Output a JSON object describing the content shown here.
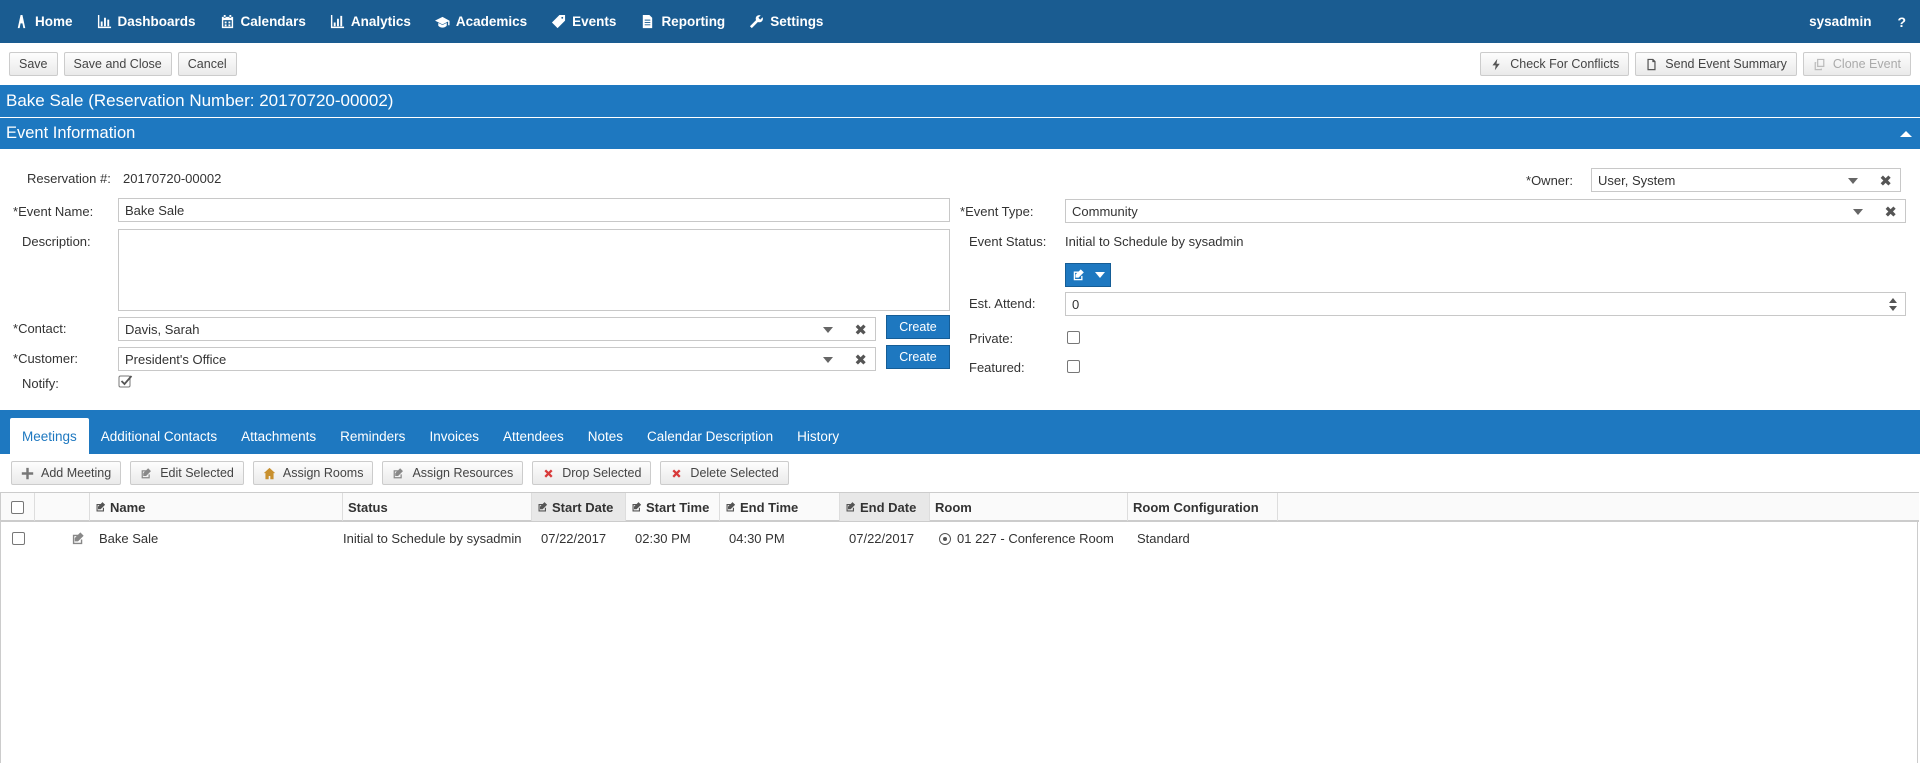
{
  "nav": {
    "items": [
      {
        "label": "Home",
        "icon": "tower-icon"
      },
      {
        "label": "Dashboards",
        "icon": "bar-chart-icon"
      },
      {
        "label": "Calendars",
        "icon": "calendar-icon"
      },
      {
        "label": "Analytics",
        "icon": "analytics-icon"
      },
      {
        "label": "Academics",
        "icon": "graduation-cap-icon"
      },
      {
        "label": "Events",
        "icon": "tag-icon"
      },
      {
        "label": "Reporting",
        "icon": "document-icon"
      },
      {
        "label": "Settings",
        "icon": "wrench-icon"
      }
    ],
    "user": "sysadmin",
    "help": "?"
  },
  "toolbar": {
    "save": "Save",
    "save_close": "Save and Close",
    "cancel": "Cancel",
    "check_conflicts": "Check For Conflicts",
    "send_summary": "Send Event Summary",
    "clone_event": "Clone Event"
  },
  "title": "Bake Sale (Reservation Number: 20170720-00002)",
  "section": "Event Information",
  "form": {
    "reservation_label": "Reservation #:",
    "reservation_value": "20170720-00002",
    "event_name_label": "Event Name:",
    "event_name_value": "Bake Sale",
    "description_label": "Description:",
    "contact_label": "Contact:",
    "contact_value": "Davis, Sarah",
    "customer_label": "Customer:",
    "customer_value": "President's Office",
    "notify_label": "Notify:",
    "create_label": "Create",
    "required_mark": "*",
    "owner_label": "Owner:",
    "owner_value": "User, System",
    "event_type_label": "Event Type:",
    "event_type_value": "Community",
    "event_status_label": "Event Status:",
    "event_status_value": "Initial to Schedule by sysadmin",
    "est_attend_label": "Est. Attend:",
    "est_attend_value": "0",
    "private_label": "Private:",
    "featured_label": "Featured:"
  },
  "tabs": [
    "Meetings",
    "Additional Contacts",
    "Attachments",
    "Reminders",
    "Invoices",
    "Attendees",
    "Notes",
    "Calendar Description",
    "History"
  ],
  "grid_toolbar": {
    "add": "Add Meeting",
    "edit": "Edit Selected",
    "assign_rooms": "Assign Rooms",
    "assign_resources": "Assign Resources",
    "drop": "Drop Selected",
    "delete": "Delete Selected"
  },
  "grid": {
    "headers": [
      "Name",
      "Status",
      "Start Date",
      "Start Time",
      "End Time",
      "End Date",
      "Room",
      "Room Configuration"
    ],
    "rows": [
      {
        "name": "Bake Sale",
        "status": "Initial to Schedule by sysadmin",
        "start_date": "07/22/2017",
        "start_time": "02:30 PM",
        "end_time": "04:30 PM",
        "end_date": "07/22/2017",
        "room": "01 227 - Conference Room",
        "room_config": "Standard"
      }
    ]
  },
  "colors": {
    "nav_bg": "#1a5c91",
    "accent": "#1e78c0"
  }
}
